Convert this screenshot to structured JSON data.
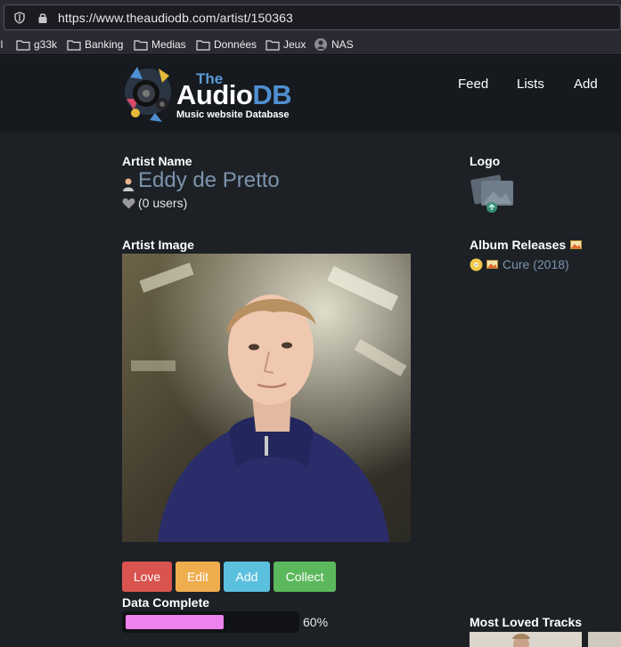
{
  "browser": {
    "url": "https://www.theaudiodb.com/artist/150363",
    "bookmarks": [
      {
        "label": "il",
        "icon": "folder-icon"
      },
      {
        "label": "g33k",
        "icon": "folder-icon"
      },
      {
        "label": "Banking",
        "icon": "folder-icon"
      },
      {
        "label": "Medias",
        "icon": "folder-icon"
      },
      {
        "label": "Données",
        "icon": "folder-icon"
      },
      {
        "label": "Jeux",
        "icon": "folder-icon"
      },
      {
        "label": "NAS",
        "icon": "nas-icon"
      }
    ]
  },
  "site": {
    "logo": {
      "the": "The",
      "audio": "Audio",
      "db": "DB",
      "tagline": "Music website Database"
    },
    "nav": [
      "Feed",
      "Lists",
      "Add"
    ]
  },
  "artist": {
    "name_label": "Artist Name",
    "name": "Eddy de Pretto",
    "users": "(0 users)",
    "image_label": "Artist Image"
  },
  "actions": {
    "love": "Love",
    "edit": "Edit",
    "add": "Add",
    "collect": "Collect"
  },
  "data_complete": {
    "label": "Data Complete",
    "percent": 60,
    "text": "60%"
  },
  "sidebar": {
    "logo_label": "Logo",
    "albums_label": "Album Releases",
    "albums": [
      {
        "title": "Cure (2018)"
      }
    ],
    "tracks_label": "Most Loved Tracks"
  },
  "colors": {
    "love": "#d9534f",
    "edit": "#f0ad4e",
    "add": "#5bc0de",
    "collect": "#5cb85c",
    "progress": "#ee82ee",
    "link": "#7d93ad"
  }
}
